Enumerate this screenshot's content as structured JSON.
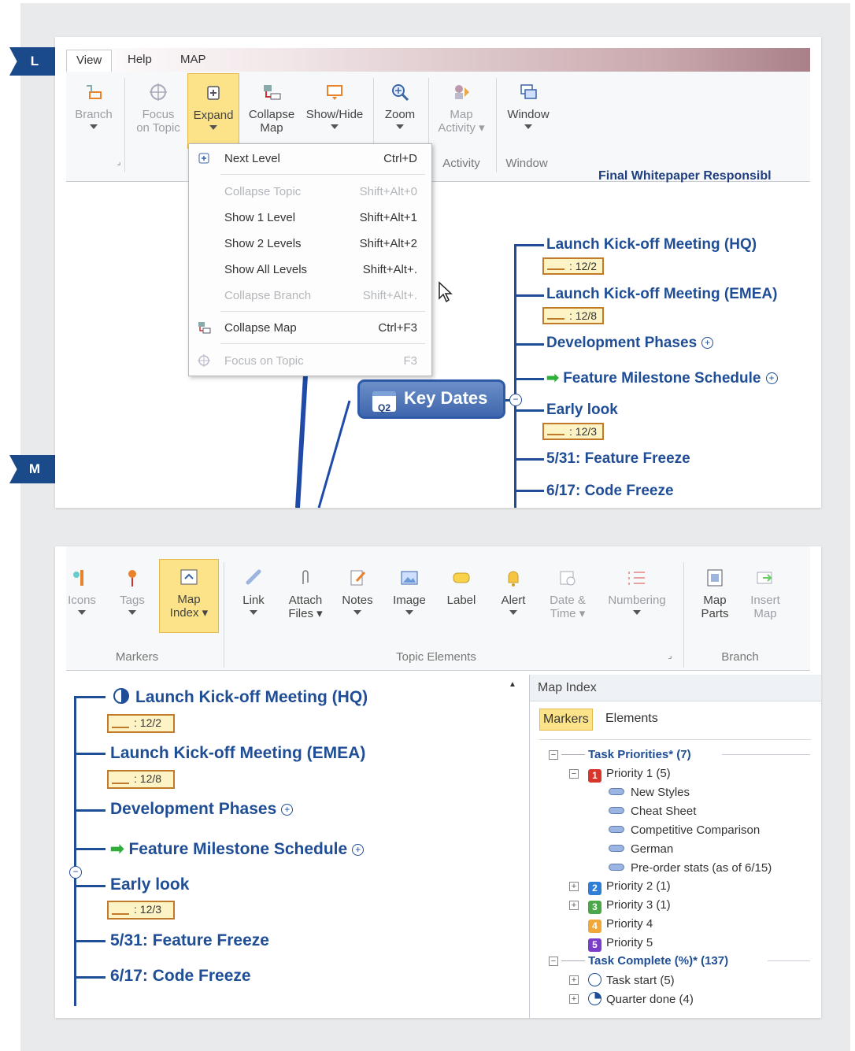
{
  "markers": {
    "l": "L",
    "m": "M"
  },
  "colors": {
    "accent": "#1f4e96",
    "highlight": "#fce38a",
    "flag": "#1a4a8a"
  },
  "shotL": {
    "tabs": [
      "View",
      "Help",
      "MAP"
    ],
    "ribbon": {
      "branch": "Branch",
      "focus": [
        "Focus",
        "on Topic"
      ],
      "expand": "Expand",
      "collapse": [
        "Collapse",
        "Map"
      ],
      "showhide": "Show/Hide",
      "zoom": "Zoom",
      "mapactivity": [
        "Map",
        "Activity"
      ],
      "window": "Window",
      "group_activity": "Activity",
      "group_window": "Window"
    },
    "dropdown": [
      {
        "label": "Next Level",
        "shortcut": "Ctrl+D",
        "disabled": false,
        "icon": "expand-icon"
      },
      {
        "label": "Collapse Topic",
        "shortcut": "Shift+Alt+0",
        "disabled": true
      },
      {
        "label": "Show 1 Level",
        "shortcut": "Shift+Alt+1",
        "disabled": false
      },
      {
        "label": "Show 2 Levels",
        "shortcut": "Shift+Alt+2",
        "disabled": false
      },
      {
        "label": "Show All Levels",
        "shortcut": "Shift+Alt+.",
        "disabled": false
      },
      {
        "label": "Collapse Branch",
        "shortcut": "Shift+Alt+.",
        "disabled": true
      },
      {
        "label": "Collapse Map",
        "shortcut": "Ctrl+F3",
        "disabled": false,
        "icon": "collapse-map-icon"
      },
      {
        "label": "Focus on Topic",
        "shortcut": "F3",
        "disabled": true,
        "icon": "focus-icon"
      }
    ],
    "partial_topic": "Final Whitepaper Responsibl",
    "central_topic": "Key Dates",
    "central_badge": "Q2",
    "topics": [
      {
        "label": "Launch Kick-off Meeting (HQ)",
        "date": ": 12/2"
      },
      {
        "label": "Launch Kick-off Meeting (EMEA)",
        "date": ": 12/8"
      },
      {
        "label": "Development Phases"
      },
      {
        "label": "Feature Milestone Schedule"
      },
      {
        "label": "Early look",
        "date": ": 12/3"
      },
      {
        "label": "5/31: Feature Freeze"
      },
      {
        "label": "6/17: Code Freeze"
      }
    ]
  },
  "shotM": {
    "ribbon": {
      "icons": "Icons",
      "tags": "Tags",
      "mapindex": [
        "Map",
        "Index"
      ],
      "link": "Link",
      "attach": [
        "Attach",
        "Files"
      ],
      "notes": "Notes",
      "image": "Image",
      "label": "Label",
      "alert": "Alert",
      "datetime": [
        "Date &",
        "Time"
      ],
      "numbering": "Numbering",
      "mapparts": [
        "Map",
        "Parts"
      ],
      "insertmap": [
        "Insert",
        "Map"
      ],
      "group_markers": "Markers",
      "group_topic": "Topic Elements",
      "group_branch": "Branch"
    },
    "topics": [
      {
        "label": "Launch Kick-off Meeting (HQ)",
        "date": ": 12/2"
      },
      {
        "label": "Launch Kick-off Meeting (EMEA)",
        "date": ": 12/8"
      },
      {
        "label": "Development Phases"
      },
      {
        "label": "Feature Milestone Schedule"
      },
      {
        "label": "Early look",
        "date": ": 12/3"
      },
      {
        "label": "5/31: Feature Freeze"
      },
      {
        "label": "6/17: Code Freeze"
      }
    ],
    "mapindex": {
      "title": "Map Index",
      "tab_markers": "Markers",
      "tab_elements": "Elements",
      "task_priorities": "Task Priorities* (7)",
      "priority1": "Priority 1 (5)",
      "items": [
        "New Styles",
        "Cheat Sheet",
        "Competitive Comparison",
        "German",
        "Pre-order stats (as of 6/15)"
      ],
      "priority2": "Priority 2 (1)",
      "priority3": "Priority 3 (1)",
      "priority4": "Priority 4",
      "priority5": "Priority 5",
      "task_complete": "Task Complete (%)* (137)",
      "task_start": "Task start (5)",
      "quarter_done": "Quarter done (4)",
      "badges": [
        "1",
        "2",
        "3",
        "4",
        "5"
      ]
    }
  }
}
